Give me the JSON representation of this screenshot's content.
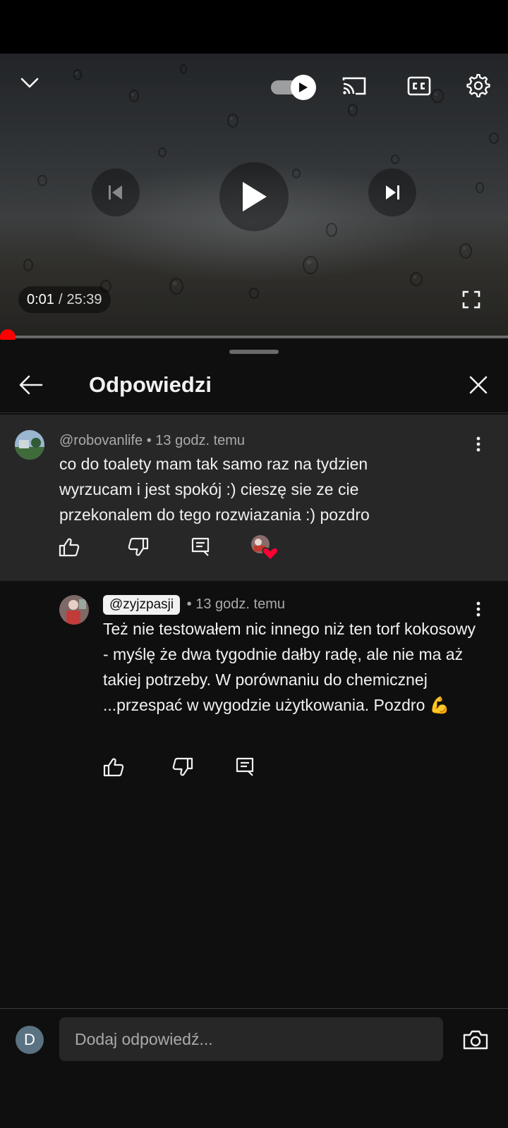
{
  "player": {
    "current_time": "0:01",
    "time_separator": "/",
    "duration": "25:39",
    "progress_fraction": 0.0007
  },
  "sheet": {
    "title": "Odpowiedzi"
  },
  "parent_comment": {
    "author": "@robovanlife",
    "meta_separator": "•",
    "time": "13 godz. temu",
    "text": "co do toalety mam tak samo raz na tydzien wyrzucam i jest spokój :) cieszę sie ze cie przekonalem do tego rozwiazania :) pozdro"
  },
  "reply_comment": {
    "author": "@zyjzpasji",
    "meta_separator": "•",
    "time": "13 godz. temu",
    "text": "Też nie testowałem nic innego niż ten torf kokosowy - myślę że dwa tygodnie dałby radę, ale nie ma aż takiej potrzeby. W porównaniu do chemicznej ...przespać w wygodzie użytkowania. Pozdro 💪"
  },
  "composer": {
    "avatar_letter": "D",
    "placeholder": "Dodaj odpowiedź..."
  },
  "colors": {
    "accent": "#ff0000",
    "heart": "#ff0033",
    "background": "#0f0f0f",
    "highlight": "#272727"
  }
}
